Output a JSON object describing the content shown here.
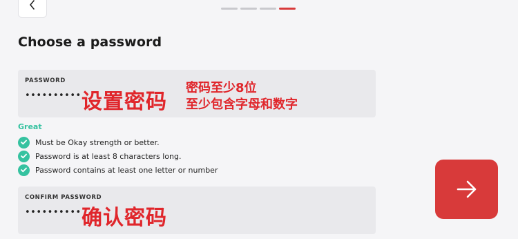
{
  "header": {
    "progress": {
      "total": 4,
      "current": 4
    },
    "back_icon": "chevron-left-icon"
  },
  "page": {
    "title": "Choose a password"
  },
  "password_field": {
    "label": "PASSWORD",
    "value": "•••••••••••"
  },
  "strength": {
    "label": "Great",
    "color": "#35c2a0"
  },
  "requirements": [
    {
      "text": "Must be Okay strength or better.",
      "met": true
    },
    {
      "text": "Password is at least 8 characters long.",
      "met": true
    },
    {
      "text": "Password contains at least one letter or number",
      "met": true
    }
  ],
  "confirm_field": {
    "label": "CONFIRM PASSWORD",
    "value": "•••••••••••"
  },
  "annotations": {
    "set_password": "设置密码",
    "rule_line1": "密码至少8位",
    "rule_line2": "至少包含字母和数字",
    "confirm_password": "确认密码"
  },
  "next_button": {
    "icon": "arrow-right-icon",
    "color": "#d83a3a"
  },
  "colors": {
    "accent": "#d83a3a",
    "success": "#35c2a0",
    "annotation": "#e0262b"
  }
}
